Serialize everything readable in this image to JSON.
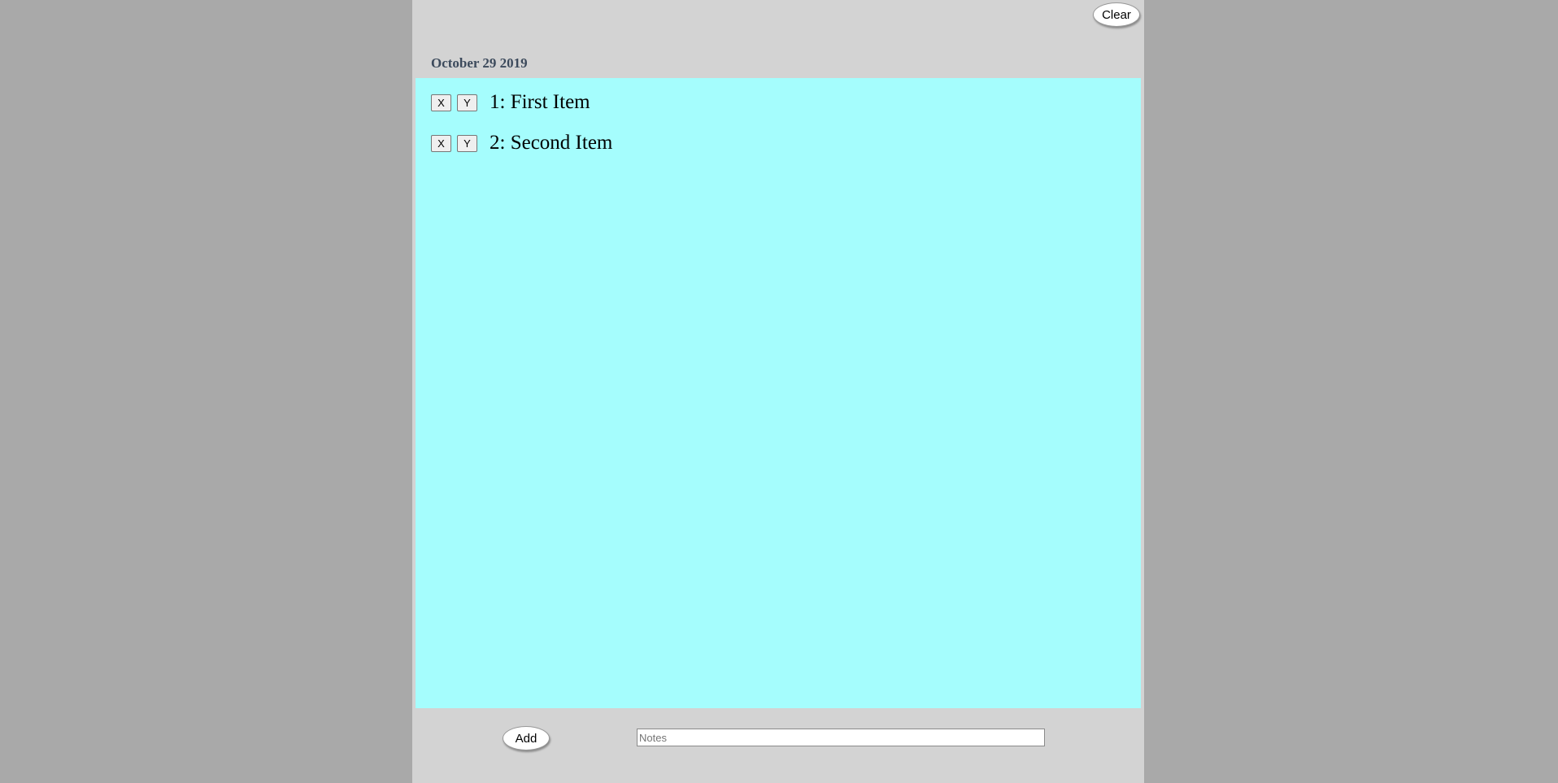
{
  "header": {
    "clear_label": "Clear",
    "date": "October 29 2019"
  },
  "list": {
    "items": [
      {
        "x_label": "X",
        "y_label": "Y",
        "text": "1: First Item"
      },
      {
        "x_label": "X",
        "y_label": "Y",
        "text": "2: Second Item"
      }
    ]
  },
  "footer": {
    "add_label": "Add",
    "notes_value": "",
    "notes_placeholder": "Notes"
  },
  "colors": {
    "page_background": "#a9a9a9",
    "panel_background": "#d3d3d3",
    "list_background": "#a5fdfd",
    "date_text": "#3c4a5c"
  }
}
